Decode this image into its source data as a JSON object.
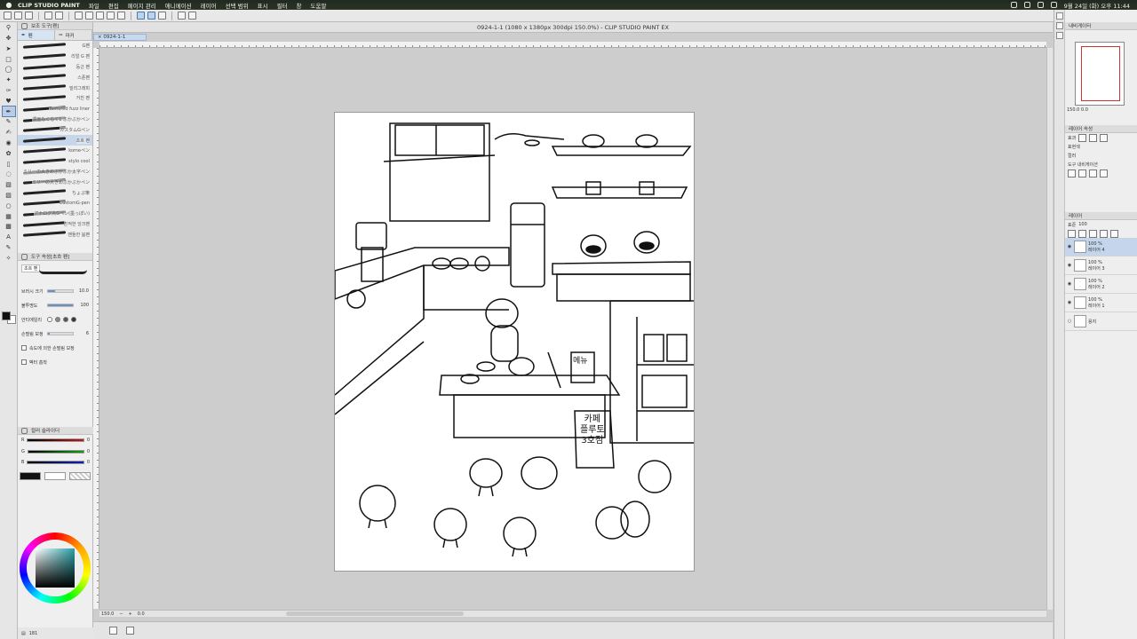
{
  "mac_menubar": {
    "apple": "",
    "app_name": "CLIP STUDIO PAINT",
    "items": [
      "파일",
      "편집",
      "페이지 관리",
      "애니메이션",
      "레이어",
      "선택 범위",
      "표시",
      "필터",
      "창",
      "도움말"
    ],
    "datetime": "9월 24일 (화) 오후 11:44"
  },
  "window_title": "0924-1-1 (1080 x 1380px 300dpi 150.0%)  - CLIP STUDIO PAINT EX",
  "doc_tab": "0924-1-1",
  "sub_tool_panel": {
    "title": "보조 도구[펜]",
    "tabs": [
      "펜",
      "마커"
    ],
    "brushes": [
      "G펜",
      "리얼 G 펜",
      "둥근 펜",
      "스푼펜",
      "밀리그래피",
      "거친 펜",
      "Textured fuzz liner",
      "漫画もくもく1 ぶかぶかペン",
      "カスタムGペン",
      "초흐 펜",
      "komeペン",
      "stylo cool",
      "ミリーの大きめぶかぶか太字ペン",
      "ミリーの大きめぶかぶかペン",
      "ちょぷ筆",
      "CustomG-pen",
      "アナログ丸Gペン(墨っぽい)",
      "끈적한 잉크펜",
      "맨들한 붐펜"
    ],
    "selected_index": 9
  },
  "tool_property": {
    "title": "도구 속성[초흐 펜]",
    "preview_label": "초흐 펜",
    "brush_size_label": "브러시 크기",
    "brush_size_value": "10.0",
    "opacity_label": "불투명도",
    "opacity_value": "100",
    "antialias_label": "안티에일리",
    "stabilization_label": "손떨림 보정",
    "stabilization_value": "6",
    "speed_correction_label": "속도에 의한 손떨림 보정",
    "vector_snap_label": "벡터 흡착"
  },
  "color_slider": {
    "title": "컬러 슬라이더",
    "mode_labels": [
      "RGB",
      "HSV",
      "CMY"
    ],
    "rows": [
      {
        "label": "R",
        "value": "0",
        "color": "#d01010"
      },
      {
        "label": "G",
        "value": "0",
        "color": "#10a010"
      },
      {
        "label": "B",
        "value": "0",
        "color": "#1020c0"
      }
    ]
  },
  "status": {
    "memory": "181"
  },
  "canvas": {
    "zoom": "150.0",
    "rotation": "0.0"
  },
  "navigator": {
    "title": "내비게이터",
    "zoom": "150.0",
    "rotation": "0.0"
  },
  "layer_property": {
    "title": "레이어 속성",
    "effect_label": "효과",
    "expression_label": "표현색",
    "expression_value": "컬러",
    "tool_nav_label": "도구 내비게이션"
  },
  "layer_panel": {
    "title": "레이어",
    "blend_mode": "표준",
    "opacity": "100",
    "layers": [
      {
        "percent": "100 %",
        "mode": "표준",
        "name": "레이어 4",
        "selected": true
      },
      {
        "percent": "100 %",
        "mode": "표준",
        "name": "레이어 3",
        "selected": false
      },
      {
        "percent": "100 %",
        "mode": "표준",
        "name": "레이어 2",
        "selected": false
      },
      {
        "percent": "100 %",
        "mode": "표준",
        "name": "레이어 1",
        "selected": false
      },
      {
        "percent": "",
        "mode": "",
        "name": "용지",
        "selected": false
      }
    ]
  },
  "drawing_text": {
    "menu": "메뉴",
    "sign_line1": "카페",
    "sign_line2": "플루토",
    "sign_line3": "3호점"
  },
  "colors": {
    "accent": "#4a77b0",
    "selection": "#c5d6ec",
    "foreground": "#111111",
    "background": "#ffffff"
  }
}
